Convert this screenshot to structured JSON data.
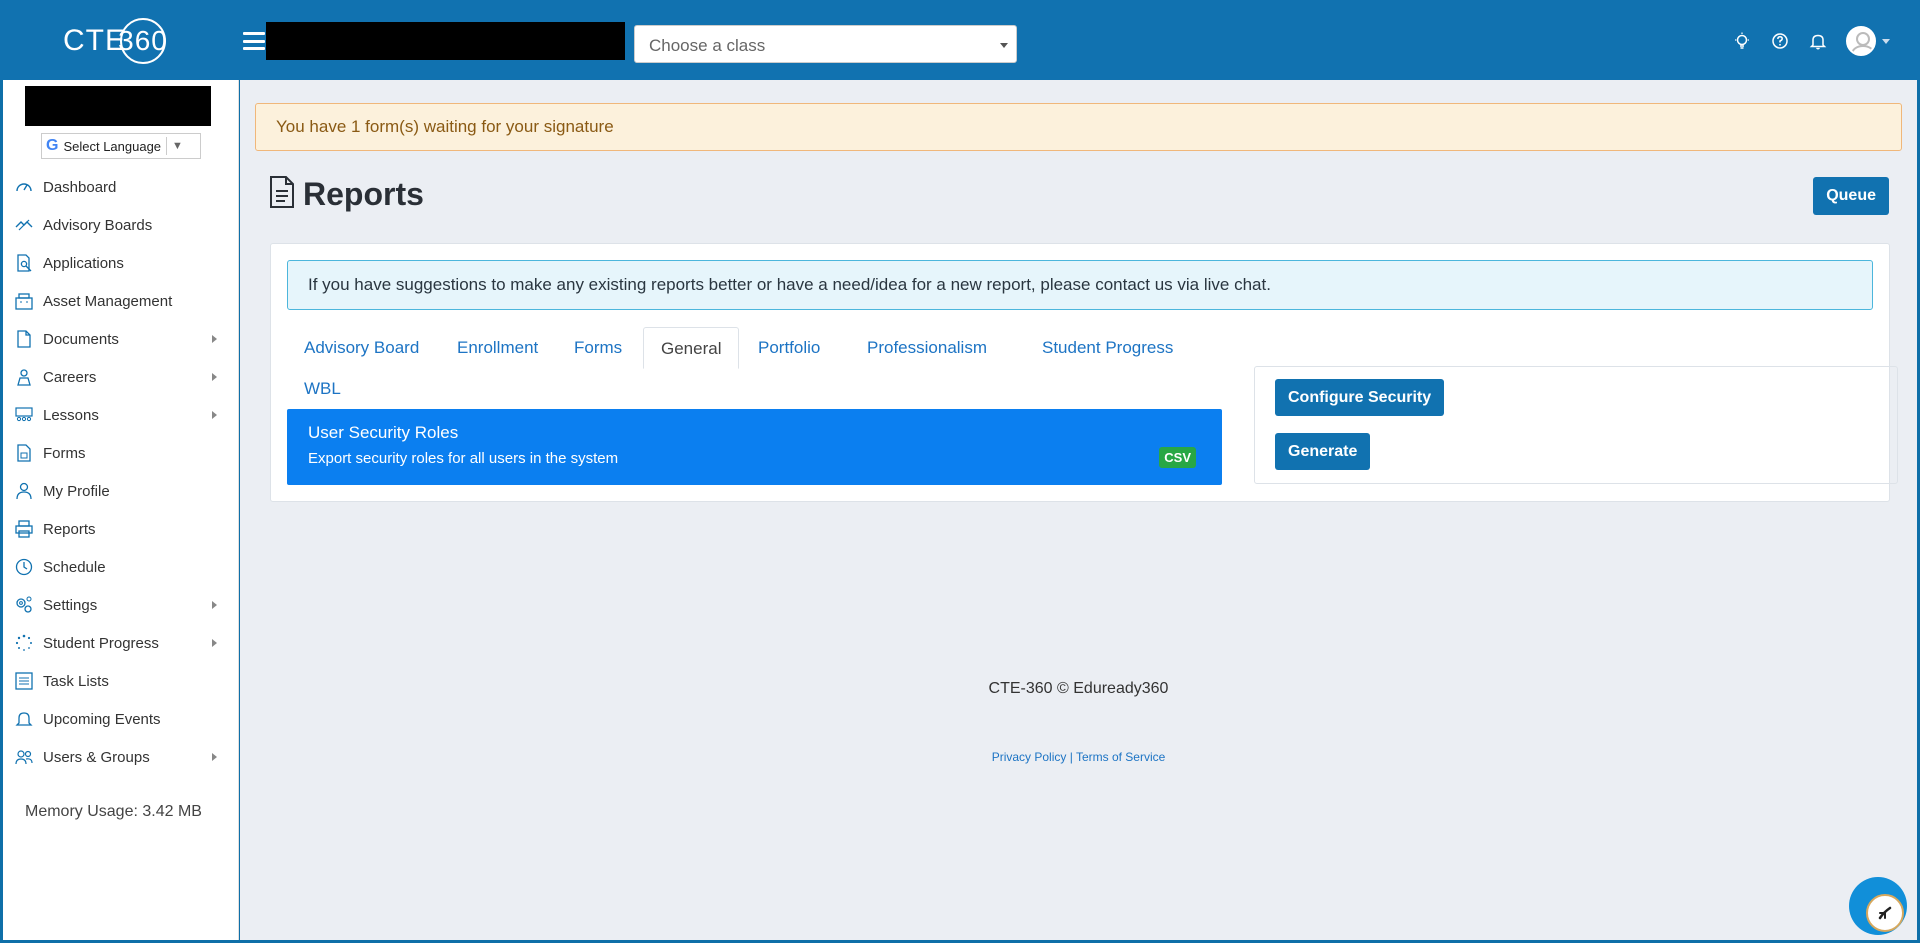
{
  "header": {
    "logo_text": "CTE",
    "logo_number": "360",
    "class_select_placeholder": "Choose a class"
  },
  "sidebar": {
    "language_label": "Select Language",
    "items": [
      {
        "label": "Dashboard",
        "icon": "gauge-icon",
        "has_submenu": false
      },
      {
        "label": "Advisory Boards",
        "icon": "handshake-icon",
        "has_submenu": false
      },
      {
        "label": "Applications",
        "icon": "document-search-icon",
        "has_submenu": false
      },
      {
        "label": "Asset Management",
        "icon": "building-icon",
        "has_submenu": false
      },
      {
        "label": "Documents",
        "icon": "file-icon",
        "has_submenu": true
      },
      {
        "label": "Careers",
        "icon": "career-icon",
        "has_submenu": true
      },
      {
        "label": "Lessons",
        "icon": "classroom-icon",
        "has_submenu": true
      },
      {
        "label": "Forms",
        "icon": "form-icon",
        "has_submenu": false
      },
      {
        "label": "My Profile",
        "icon": "user-icon",
        "has_submenu": false
      },
      {
        "label": "Reports",
        "icon": "printer-icon",
        "has_submenu": false
      },
      {
        "label": "Schedule",
        "icon": "clock-icon",
        "has_submenu": false
      },
      {
        "label": "Settings",
        "icon": "gears-icon",
        "has_submenu": true
      },
      {
        "label": "Student Progress",
        "icon": "spinner-icon",
        "has_submenu": true
      },
      {
        "label": "Task Lists",
        "icon": "list-icon",
        "has_submenu": false
      },
      {
        "label": "Upcoming Events",
        "icon": "bell-icon",
        "has_submenu": false
      },
      {
        "label": "Users & Groups",
        "icon": "users-icon",
        "has_submenu": true
      }
    ],
    "memory_usage": "Memory Usage: 3.42 MB"
  },
  "main": {
    "alert_text": "You have 1 form(s) waiting for your signature",
    "page_title": "Reports",
    "queue_label": "Queue",
    "info_text": "If you have suggestions to make any existing reports better or have a need/idea for a new report, please contact us via live chat.",
    "tabs": [
      {
        "label": "Advisory Board",
        "active": false
      },
      {
        "label": "Enrollment",
        "active": false
      },
      {
        "label": "Forms",
        "active": false
      },
      {
        "label": "General",
        "active": true
      },
      {
        "label": "Portfolio",
        "active": false
      },
      {
        "label": "Professionalism",
        "active": false
      },
      {
        "label": "Student Progress",
        "active": false
      },
      {
        "label": "WBL",
        "active": false
      }
    ],
    "report": {
      "title": "User Security Roles",
      "description": "Export security roles for all users in the system",
      "format_badge": "CSV"
    },
    "configure_security_label": "Configure Security",
    "generate_label": "Generate"
  },
  "footer": {
    "copyright": "CTE-360 © Eduready360",
    "privacy_label": "Privacy Policy",
    "separator": " | ",
    "terms_label": "Terms of Service"
  },
  "colors": {
    "brand": "#1172b0",
    "report_item": "#0b7ff0",
    "badge": "#28a745"
  }
}
